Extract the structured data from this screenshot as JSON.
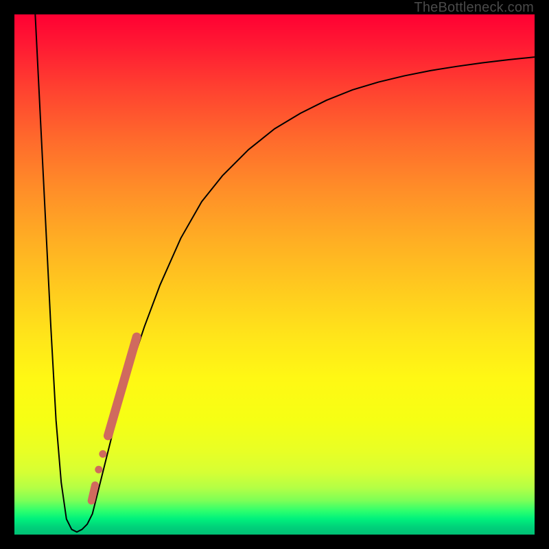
{
  "watermark": "TheBottleneck.com",
  "colors": {
    "frame": "#000000",
    "curve": "#000000",
    "marker_fill": "#d06a5e",
    "marker_stroke": "#c45a4d"
  },
  "chart_data": {
    "type": "line",
    "title": "",
    "xlabel": "",
    "ylabel": "",
    "xlim": [
      0,
      100
    ],
    "ylim": [
      0,
      100
    ],
    "background": "vertical-rainbow-gradient (red→yellow→green)",
    "series": [
      {
        "name": "bottleneck-curve",
        "x": [
          4.0,
          5.0,
          6.0,
          7.0,
          8.0,
          9.0,
          10.0,
          11.0,
          12.0,
          13.0,
          14.0,
          15.0,
          16.0,
          18.0,
          20.0,
          22.0,
          25.0,
          28.0,
          32.0,
          36.0,
          40.0,
          45.0,
          50.0,
          55.0,
          60.0,
          65.0,
          70.0,
          75.0,
          80.0,
          85.0,
          90.0,
          95.0,
          100.0
        ],
        "y": [
          100,
          80,
          60,
          40,
          22,
          10,
          3,
          1,
          0.5,
          1,
          2,
          4,
          8,
          16,
          24,
          31,
          40,
          48,
          57,
          64,
          69,
          74,
          78,
          81,
          83.5,
          85.5,
          87,
          88.2,
          89.2,
          90,
          90.7,
          91.3,
          91.8
        ]
      }
    ],
    "markers": [
      {
        "name": "segment-a-start",
        "x": 14.8,
        "y": 6.5
      },
      {
        "name": "segment-a-end",
        "x": 15.5,
        "y": 9.5
      },
      {
        "name": "dot-b",
        "x": 16.2,
        "y": 12.5
      },
      {
        "name": "dot-c",
        "x": 17.0,
        "y": 15.5
      },
      {
        "name": "segment-d-start",
        "x": 18.0,
        "y": 19.0
      },
      {
        "name": "segment-d-end",
        "x": 23.5,
        "y": 38.0
      }
    ]
  }
}
